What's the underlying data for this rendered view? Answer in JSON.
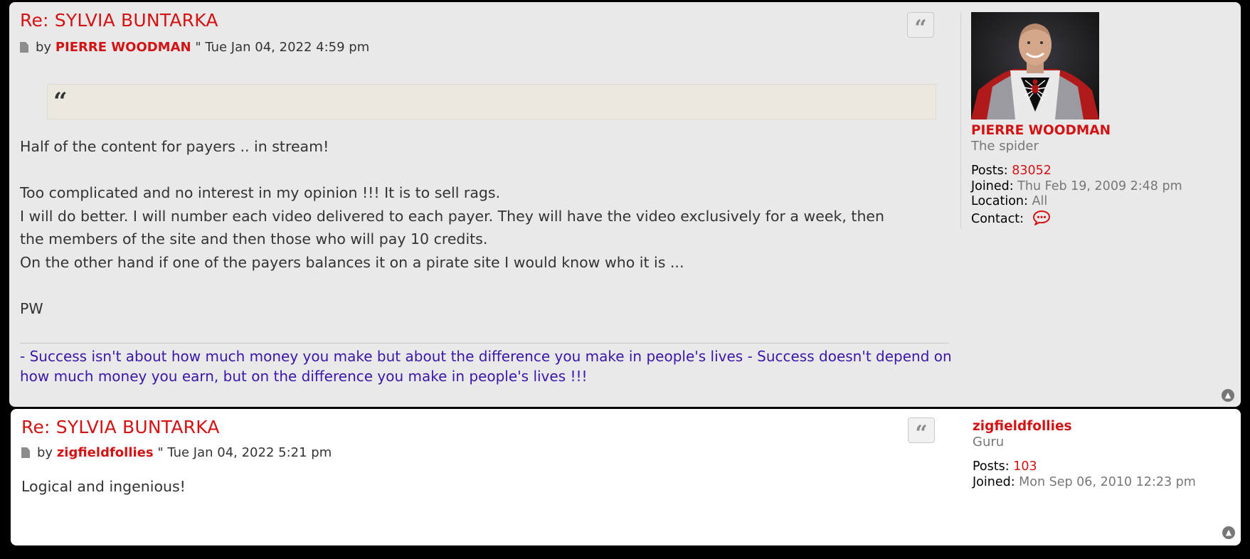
{
  "colors": {
    "accent": "#d31313",
    "signature": "#3b16a8",
    "muted": "#777777"
  },
  "posts": [
    {
      "title": "Re: SYLVIA BUNTARKA",
      "by_label": "by",
      "author": "PIERRE WOODMAN",
      "date": "\" Tue Jan 04, 2022 4:59 pm",
      "quote_icon": "quote-icon",
      "content_lines": [
        "Half of the content for payers .. in stream!",
        "",
        "Too complicated and no interest in my opinion !!! It is to sell rags.",
        "I will do better. I will number each video delivered to each payer. They will have the video exclusively for a week, then",
        "the members of the site and then those who will pay 10 credits.",
        "On the other hand if one of the payers balances it on a pirate site I would know who it is ...",
        "",
        "PW"
      ],
      "signature": "- Success isn't about how much money you make but about the difference you make in people's lives - Success doesn't depend on how much money you earn, but on the difference you make in people's lives !!!",
      "profile": {
        "username": "PIERRE WOODMAN",
        "rank": "The spider",
        "posts_label": "Posts:",
        "posts_value": "83052",
        "joined_label": "Joined:",
        "joined_value": "Thu Feb 19, 2009 2:48 pm",
        "location_label": "Location:",
        "location_value": "All",
        "contact_label": "Contact:"
      }
    },
    {
      "title": "Re: SYLVIA BUNTARKA",
      "by_label": "by",
      "author": "zigfieldfollies",
      "date": "\" Tue Jan 04, 2022 5:21 pm",
      "quote_icon": "quote-icon",
      "content_lines": [
        "Logical and ingenious!"
      ],
      "profile": {
        "username": "zigfieldfollies",
        "rank": "Guru",
        "posts_label": "Posts:",
        "posts_value": "103",
        "joined_label": "Joined:",
        "joined_value": "Mon Sep 06, 2010 12:23 pm"
      }
    }
  ]
}
